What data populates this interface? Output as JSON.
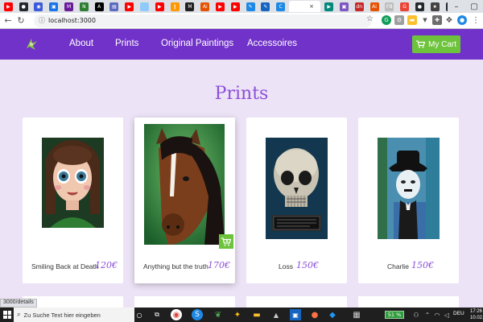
{
  "browser": {
    "url": "localhost:3000",
    "tabs": [
      {
        "icon": "youtube-icon",
        "color": "#ff0000",
        "label": "▶"
      },
      {
        "icon": "github-icon",
        "color": "#24292e",
        "label": "●"
      },
      {
        "icon": "circle-icon",
        "color": "#3b5bdb",
        "label": "◉"
      },
      {
        "icon": "camera-icon",
        "color": "#1a73e8",
        "label": "▣"
      },
      {
        "icon": "m-icon",
        "color": "#6a1b9a",
        "label": "M"
      },
      {
        "icon": "n-icon",
        "color": "#2e7d32",
        "label": "N"
      },
      {
        "icon": "a-icon",
        "color": "#000000",
        "label": "A"
      },
      {
        "icon": "doc-icon",
        "color": "#5c6bc0",
        "label": "▤"
      },
      {
        "icon": "youtube-icon",
        "color": "#ff0000",
        "label": "▶"
      },
      {
        "icon": "blank-icon",
        "color": "#90caf9",
        "label": ""
      },
      {
        "icon": "youtube-icon",
        "color": "#ff0000",
        "label": "▶"
      },
      {
        "icon": "bookmark-icon",
        "color": "#ff9800",
        "label": "❙"
      },
      {
        "icon": "m-icon",
        "color": "#212121",
        "label": "M"
      },
      {
        "icon": "ai-icon",
        "color": "#e65100",
        "label": "Ai"
      },
      {
        "icon": "youtube-icon",
        "color": "#ff0000",
        "label": "▶"
      },
      {
        "icon": "youtube-icon",
        "color": "#ff0000",
        "label": "▶"
      },
      {
        "icon": "feather-icon",
        "color": "#1e88e5",
        "label": "✎"
      },
      {
        "icon": "feather-icon",
        "color": "#1565c0",
        "label": "✎"
      },
      {
        "icon": "c-icon",
        "color": "#1e88e5",
        "label": "C"
      }
    ],
    "active_tab_title": "",
    "tabs_right": [
      {
        "icon": "meet-icon",
        "color": "#00897b",
        "label": "▶"
      },
      {
        "icon": "square-icon",
        "color": "#7e57c2",
        "label": "▣"
      },
      {
        "icon": "dn-icon",
        "color": "#c62828",
        "label": "dn"
      },
      {
        "icon": "ai-icon",
        "color": "#e65100",
        "label": "Ai"
      },
      {
        "icon": "fb-icon",
        "color": "#bdbdbd",
        "label": "FB"
      },
      {
        "icon": "google-icon",
        "color": "#ea4335",
        "label": "G"
      },
      {
        "icon": "github-icon",
        "color": "#24292e",
        "label": "●"
      },
      {
        "icon": "star-icon",
        "color": "#424242",
        "label": "★"
      },
      {
        "icon": "github-icon",
        "color": "#24292e",
        "label": "●"
      },
      {
        "icon": "gear-icon",
        "color": "#2e7d32",
        "label": "⚙"
      }
    ]
  },
  "site": {
    "nav": [
      "About",
      "Prints",
      "Original Paintings",
      "Accessoires"
    ],
    "cart_label": "My Cart",
    "page_title": "Prints",
    "accent": "#7132c9",
    "green": "#6ec33c"
  },
  "products": [
    {
      "name": "Smiling Back at Death",
      "price": "120€",
      "image": "girl-portrait-painting"
    },
    {
      "name": "Anything but the truth",
      "price": "170€",
      "image": "horse-painting"
    },
    {
      "name": "Loss",
      "price": "150€",
      "image": "skull-painting"
    },
    {
      "name": "Charlie",
      "price": "150€",
      "image": "charlie-chaplin-painting"
    }
  ],
  "statusbar": {
    "link": "3000/details"
  },
  "taskbar": {
    "search_placeholder": "Zu Suche Text hier eingeben",
    "battery": "51 %",
    "lang": "DEU",
    "time": "17:26",
    "date": "10.02.20"
  }
}
